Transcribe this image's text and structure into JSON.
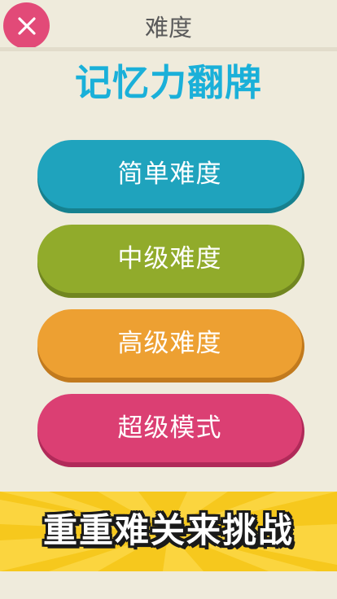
{
  "header": {
    "title": "难度",
    "close_icon": "close-icon"
  },
  "app": {
    "title": "记忆力翻牌"
  },
  "difficulty": {
    "easy": "简单难度",
    "medium": "中级难度",
    "hard": "高级难度",
    "super": "超级模式"
  },
  "banner": {
    "text": "重重难关来挑战"
  },
  "colors": {
    "background": "#efebdc",
    "close": "#e24a78",
    "title_accent": "#1ab0d9",
    "easy": "#1fa3bd",
    "medium": "#91ab2b",
    "hard": "#eda032",
    "super": "#db3f73",
    "banner": "#f6c81d"
  }
}
